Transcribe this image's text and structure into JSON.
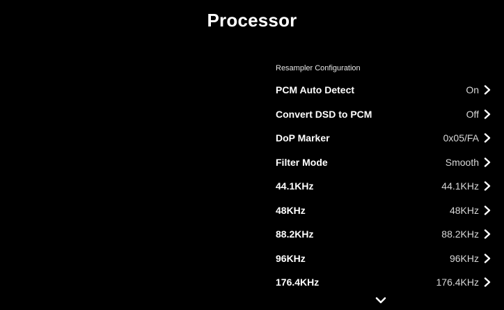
{
  "screen": {
    "title": "Processor"
  },
  "section": {
    "label": "Resampler Configuration"
  },
  "settings": [
    {
      "label": "PCM Auto Detect",
      "value": "On"
    },
    {
      "label": "Convert DSD to PCM",
      "value": "Off"
    },
    {
      "label": "DoP Marker",
      "value": "0x05/FA"
    },
    {
      "label": "Filter Mode",
      "value": "Smooth"
    },
    {
      "label": "44.1KHz",
      "value": "44.1KHz"
    },
    {
      "label": "48KHz",
      "value": "48KHz"
    },
    {
      "label": "88.2KHz",
      "value": "88.2KHz"
    },
    {
      "label": "96KHz",
      "value": "96KHz"
    },
    {
      "label": "176.4KHz",
      "value": "176.4KHz"
    }
  ],
  "icons": {
    "row_chevron": "chevron-right-icon",
    "scroll": "chevron-down-icon"
  },
  "colors": {
    "background": "#000000",
    "text": "#ffffff",
    "value_text": "#d8d8d8"
  }
}
